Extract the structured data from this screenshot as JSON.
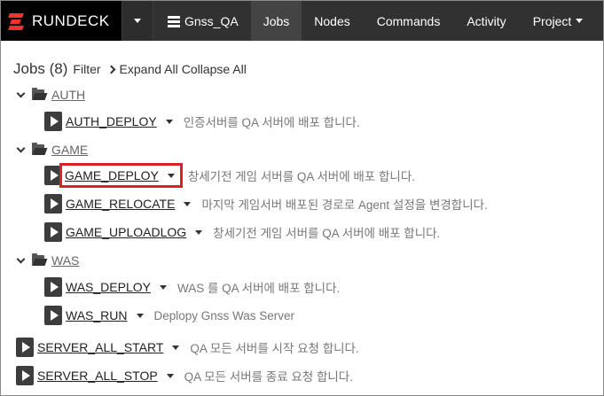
{
  "navbar": {
    "brand": "RUNDECK",
    "project_name": "Gnss_QA",
    "items": [
      "Jobs",
      "Nodes",
      "Commands",
      "Activity"
    ],
    "project_menu": "Project"
  },
  "jobs_header": {
    "title": "Jobs (8)",
    "filter": "Filter",
    "expand_all": "Expand All",
    "collapse_all": "Collapse All"
  },
  "groups": [
    {
      "name": "AUTH",
      "jobs": [
        {
          "name": "AUTH_DEPLOY",
          "description": "인증서버를 QA 서버에 배포 합니다."
        }
      ]
    },
    {
      "name": "GAME",
      "jobs": [
        {
          "name": "GAME_DEPLOY",
          "description": "창세기전 게임 서버를 QA 서버에 배포 합니다."
        },
        {
          "name": "GAME_RELOCATE",
          "description": "마지막 게임서버 배포된 경로로 Agent 설정을 변경합니다."
        },
        {
          "name": "GAME_UPLOADLOG",
          "description": "창세기전 게임 서버를 QA 서버에 배포 합니다."
        }
      ]
    },
    {
      "name": "WAS",
      "jobs": [
        {
          "name": "WAS_DEPLOY",
          "description": "WAS 를 QA 서버에 배포 합니다."
        },
        {
          "name": "WAS_RUN",
          "description": "Deplopy Gnss Was Server"
        }
      ]
    }
  ],
  "root_jobs": [
    {
      "name": "SERVER_ALL_START",
      "description": "QA 모든 서버를 시작 요청 합니다."
    },
    {
      "name": "SERVER_ALL_STOP",
      "description": "QA 모든 서버를 종료 요청 합니다."
    }
  ],
  "highlight_color": "#e02020"
}
